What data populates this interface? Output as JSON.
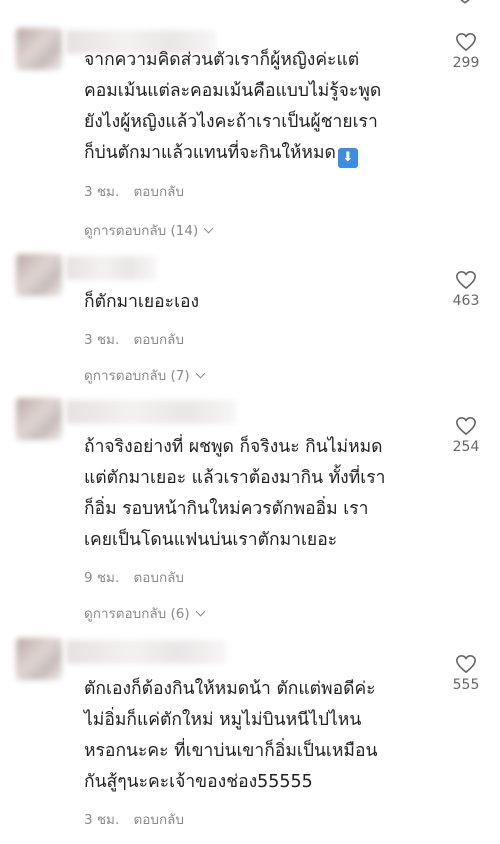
{
  "comments": [
    {
      "text": "จากความคิดส่วนตัวเราก็ผู้หญิงค่ะแต่\nคอมเม้นแต่ละคอมเม้นคือแบบไม่รู้จะพูด\nยังไงผู้หญิงแล้วไงคะถ้าเราเป็นผู้ชายเรา\nก็บ่นตักมาแล้วแทนที่จะกินให้หมด",
      "emoji": "⬇",
      "time": "3 ชม.",
      "reply_label": "ตอบกลับ",
      "view_replies": "ดูการตอบกลับ (14)",
      "likes": "299"
    },
    {
      "text": "ก็ตักมาเยอะเอง",
      "time": "3 ชม.",
      "reply_label": "ตอบกลับ",
      "view_replies": "ดูการตอบกลับ (7)",
      "likes": "463"
    },
    {
      "text": "ถ้าจริงอย่างที่ ผชพูด ก็จริงนะ กินไม่หมด\nแต่ตักมาเยอะ แล้วเราต้องมากิน ทั้งที่เรา\nก็อิ่ม รอบหน้ากินใหม่ควรตักพออิ่ม เรา\nเคยเป็นโดนแฟนบ่นเราตักมาเยอะ",
      "time": "9 ชม.",
      "reply_label": "ตอบกลับ",
      "view_replies": "ดูการตอบกลับ (6)",
      "likes": "254"
    },
    {
      "text": "ตักเองก็ต้องกินให้หมดน้า ตักแต่พอดีค่ะ\nไม่อิ่มก็แค่ตักใหม่ หมูไม่บินหนีไปไหน\nหรอกนะคะ ที่เขาบ่นเขาก็อิ่มเป็นเหมือน\nกันสู้ๆนะคะเจ้าของช่อง55555",
      "time": "3 ชม.",
      "reply_label": "ตอบกลับ",
      "likes": "555"
    }
  ],
  "icons": {
    "like": "heart-outline-icon",
    "expand": "chevron-down-icon",
    "emoji": "down-arrow-emoji"
  },
  "colors": {
    "text": "#222222",
    "meta": "#8a8a8a",
    "count": "#666666"
  }
}
